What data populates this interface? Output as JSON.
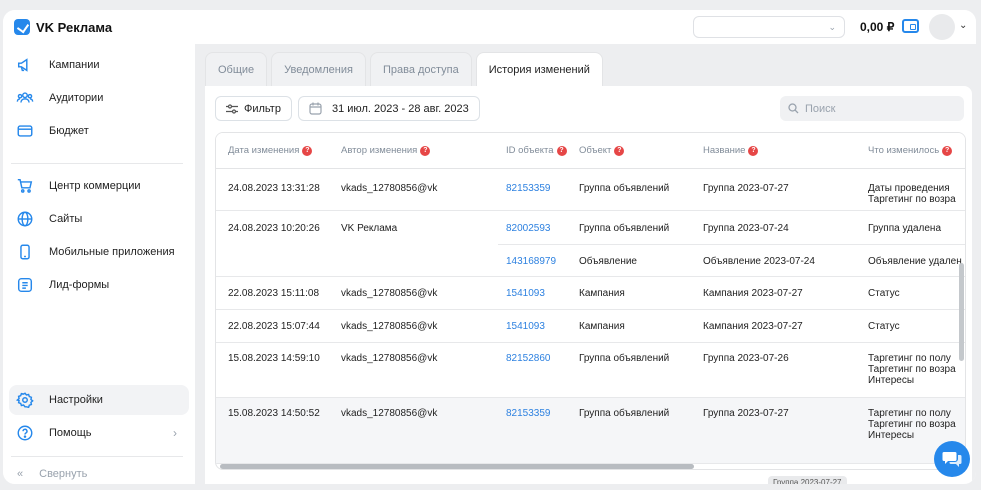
{
  "header": {
    "app_title": "VK Реклама",
    "account_select_value": "",
    "balance": "0,00 ₽"
  },
  "sidebar": {
    "items": [
      {
        "label": "Кампании",
        "icon": "megaphone-icon"
      },
      {
        "label": "Аудитории",
        "icon": "users-icon"
      },
      {
        "label": "Бюджет",
        "icon": "wallet-icon"
      },
      {
        "label": "Центр коммерции",
        "icon": "cart-icon"
      },
      {
        "label": "Сайты",
        "icon": "globe-icon"
      },
      {
        "label": "Мобильные приложения",
        "icon": "smartphone-icon"
      },
      {
        "label": "Лид-формы",
        "icon": "list-icon"
      }
    ],
    "settings_label": "Настройки",
    "help_label": "Помощь",
    "collapse_label": "Свернуть"
  },
  "tabs": [
    {
      "label": "Общие",
      "active": false
    },
    {
      "label": "Уведомления",
      "active": false
    },
    {
      "label": "Права доступа",
      "active": false
    },
    {
      "label": "История изменений",
      "active": true
    }
  ],
  "toolbar": {
    "filter_label": "Фильтр",
    "date_range": "31 июл. 2023 - 28 авг. 2023",
    "search_placeholder": "Поиск"
  },
  "table": {
    "columns": [
      "Дата изменения",
      "Автор изменения",
      "ID объекта",
      "Объект",
      "Название",
      "Что изменилось"
    ],
    "rows": [
      {
        "date": "24.08.2023 13:31:28",
        "author": "vkads_12780856@vk",
        "entries": [
          {
            "id": "82153359",
            "object": "Группа объявлений",
            "name": "Группа 2023-07-27",
            "changes": [
              "Даты проведения",
              "Таргетинг по возра"
            ]
          }
        ]
      },
      {
        "date": "24.08.2023 10:20:26",
        "author": "VK Реклама",
        "entries": [
          {
            "id": "82002593",
            "object": "Группа объявлений",
            "name": "Группа 2023-07-24",
            "changes": [
              "Группа удалена"
            ]
          },
          {
            "id": "143168979",
            "object": "Объявление",
            "name": "Объявление 2023-07-24",
            "changes": [
              "Объявление удален"
            ]
          }
        ]
      },
      {
        "date": "22.08.2023 15:11:08",
        "author": "vkads_12780856@vk",
        "entries": [
          {
            "id": "1541093",
            "object": "Кампания",
            "name": "Кампания 2023-07-27",
            "changes": [
              "Статус"
            ]
          }
        ]
      },
      {
        "date": "22.08.2023 15:07:44",
        "author": "vkads_12780856@vk",
        "entries": [
          {
            "id": "1541093",
            "object": "Кампания",
            "name": "Кампания 2023-07-27",
            "changes": [
              "Статус"
            ]
          }
        ]
      },
      {
        "date": "15.08.2023 14:59:10",
        "author": "vkads_12780856@vk",
        "entries": [
          {
            "id": "82152860",
            "object": "Группа объявлений",
            "name": "Группа 2023-07-26",
            "changes": [
              "Таргетинг по полу",
              "Таргетинг по возра",
              "Интересы"
            ]
          }
        ]
      },
      {
        "date": "15.08.2023 14:50:52",
        "author": "vkads_12780856@vk",
        "entries": [
          {
            "id": "82153359",
            "object": "Группа объявлений",
            "name": "Группа 2023-07-27",
            "changes": [
              "Таргетинг по полу",
              "Таргетинг по возра",
              "Интересы"
            ]
          }
        ]
      }
    ],
    "tooltip": "Группа 2023-07-27"
  },
  "colors": {
    "accent": "#2688eb",
    "link": "#2d81e0",
    "help_badge": "#e64646"
  }
}
